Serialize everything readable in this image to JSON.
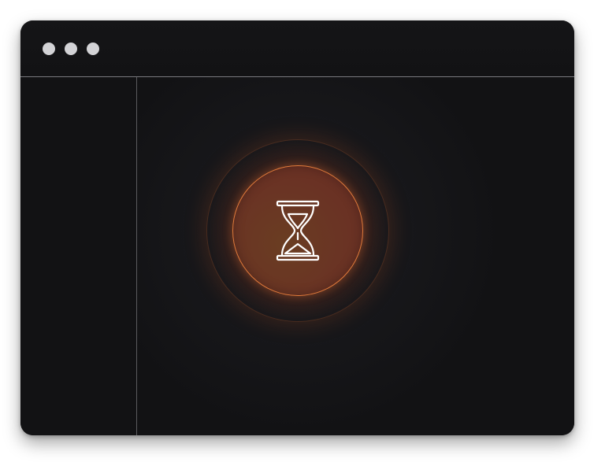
{
  "window": {
    "controls": [
      "window-dot-1",
      "window-dot-2",
      "window-dot-3"
    ],
    "colors": {
      "background": "#121214",
      "divider": "#7a7a7e",
      "dot": "#d3d3d6",
      "accent": "#e07a3b"
    }
  },
  "status_orb": {
    "icon": "hourglass-icon",
    "state": "loading"
  }
}
